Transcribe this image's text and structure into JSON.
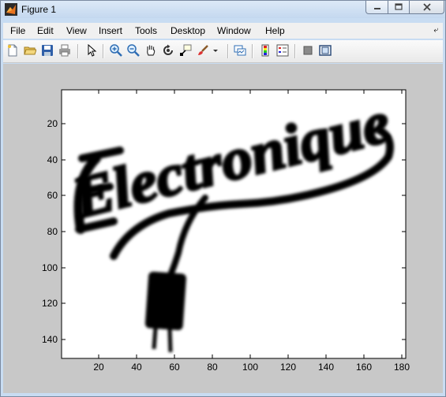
{
  "window": {
    "title": "Figure 1"
  },
  "menu": {
    "items": [
      "File",
      "Edit",
      "View",
      "Insert",
      "Tools",
      "Desktop",
      "Window",
      "Help"
    ]
  },
  "toolbar": {
    "icons": [
      "new-figure-icon",
      "open-file-icon",
      "save-icon",
      "print-icon",
      "edit-plot-arrow-icon",
      "zoom-in-icon",
      "zoom-out-icon",
      "pan-hand-icon",
      "rotate-3d-icon",
      "data-cursor-icon",
      "brush-icon",
      "brush-dropdown-icon",
      "link-plot-icon",
      "insert-colorbar-icon",
      "insert-legend-icon",
      "hide-plot-tools-icon",
      "show-plot-tools-icon"
    ]
  },
  "axes": {
    "x_ticks": [
      "20",
      "40",
      "60",
      "80",
      "100",
      "120",
      "140",
      "160",
      "180"
    ],
    "y_ticks": [
      "20",
      "40",
      "60",
      "80",
      "100",
      "120",
      "140"
    ],
    "image_text": "Electronique",
    "colors": {
      "figure_bg": "#c8c8c8",
      "axes_bg": "#ffffff",
      "ink": "#000000"
    }
  }
}
